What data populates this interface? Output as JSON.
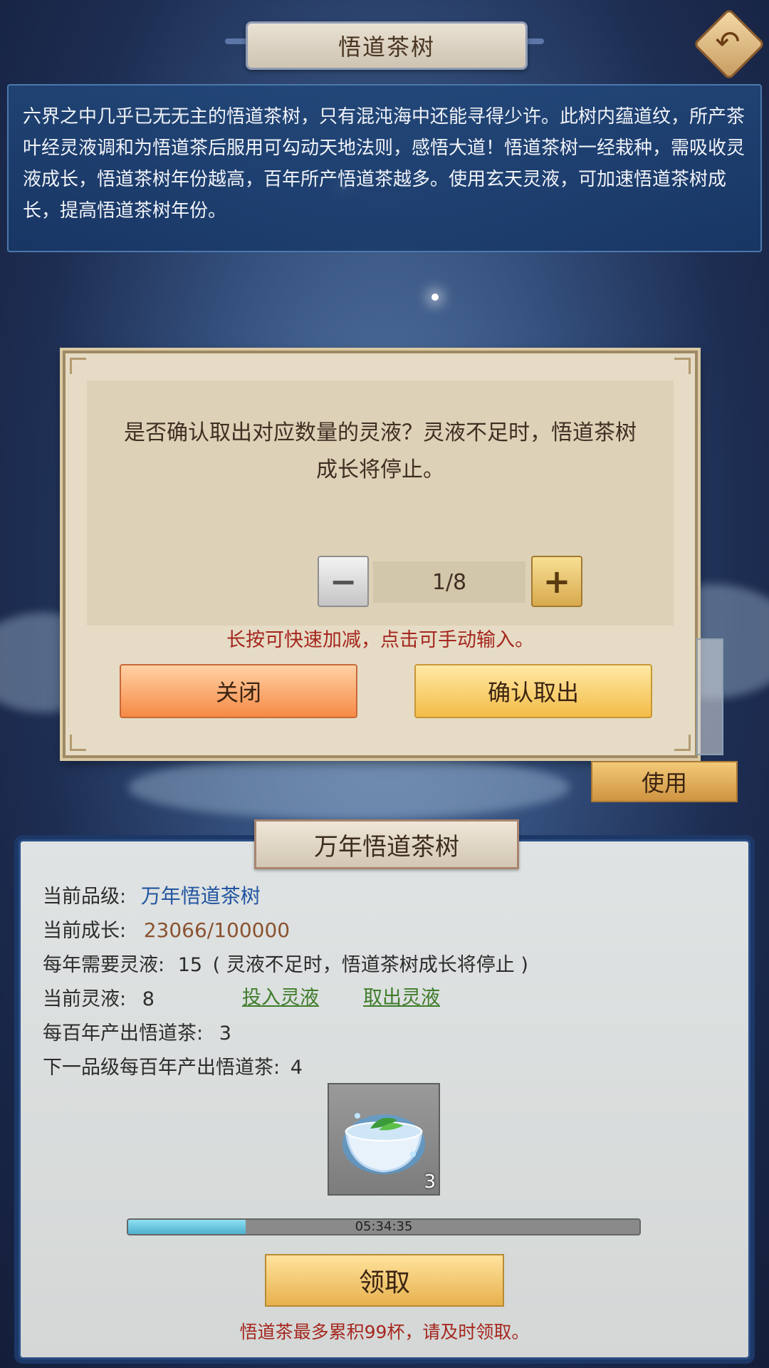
{
  "header": {
    "title": "悟道茶树"
  },
  "description": "六界之中几乎已无无主的悟道茶树，只有混沌海中还能寻得少许。此树内蕴道纹，所产茶叶经灵液调和为悟道茶后服用可勾动天地法则，感悟大道！悟道茶树一经栽种，需吸收灵液成长，悟道茶树年份越高，百年所产悟道茶越多。使用玄天灵液，可加速悟道茶树成长，提高悟道茶树年份。",
  "dialog": {
    "message_line1": "是否确认取出对应数量的灵液？灵液不足时，悟道茶树",
    "message_line2": "成长将停止。",
    "quantity": "1/8",
    "minus_glyph": "−",
    "plus_glyph": "+",
    "hint": "长按可快速加减，点击可手动输入。",
    "close_label": "关闭",
    "confirm_label": "确认取出"
  },
  "use_button": "使用",
  "tree": {
    "title": "万年悟道茶树",
    "grade_label": "当前品级:",
    "grade_value": "万年悟道茶树",
    "growth_label": "当前成长:",
    "growth_value": "23066/100000",
    "yearly_need_label": "每年需要灵液:",
    "yearly_need_value": "15",
    "yearly_need_note": "( 灵液不足时，悟道茶树成长将停止 )",
    "current_liquid_label": "当前灵液:",
    "current_liquid_value": "8",
    "deposit_link": "投入灵液",
    "withdraw_link": "取出灵液",
    "century_output_label": "每百年产出悟道茶:",
    "century_output_value": "3",
    "next_output_label": "下一品级每百年产出悟道茶:",
    "next_output_value": "4",
    "item_count": "3",
    "timer": "05:34:35",
    "progress_fraction": 0.23,
    "claim_label": "领取",
    "claim_note": "悟道茶最多累积99杯，请及时领取。"
  },
  "icons": [
    "back-arrow-icon",
    "tea-cup-icon",
    "minus-icon",
    "plus-icon"
  ]
}
